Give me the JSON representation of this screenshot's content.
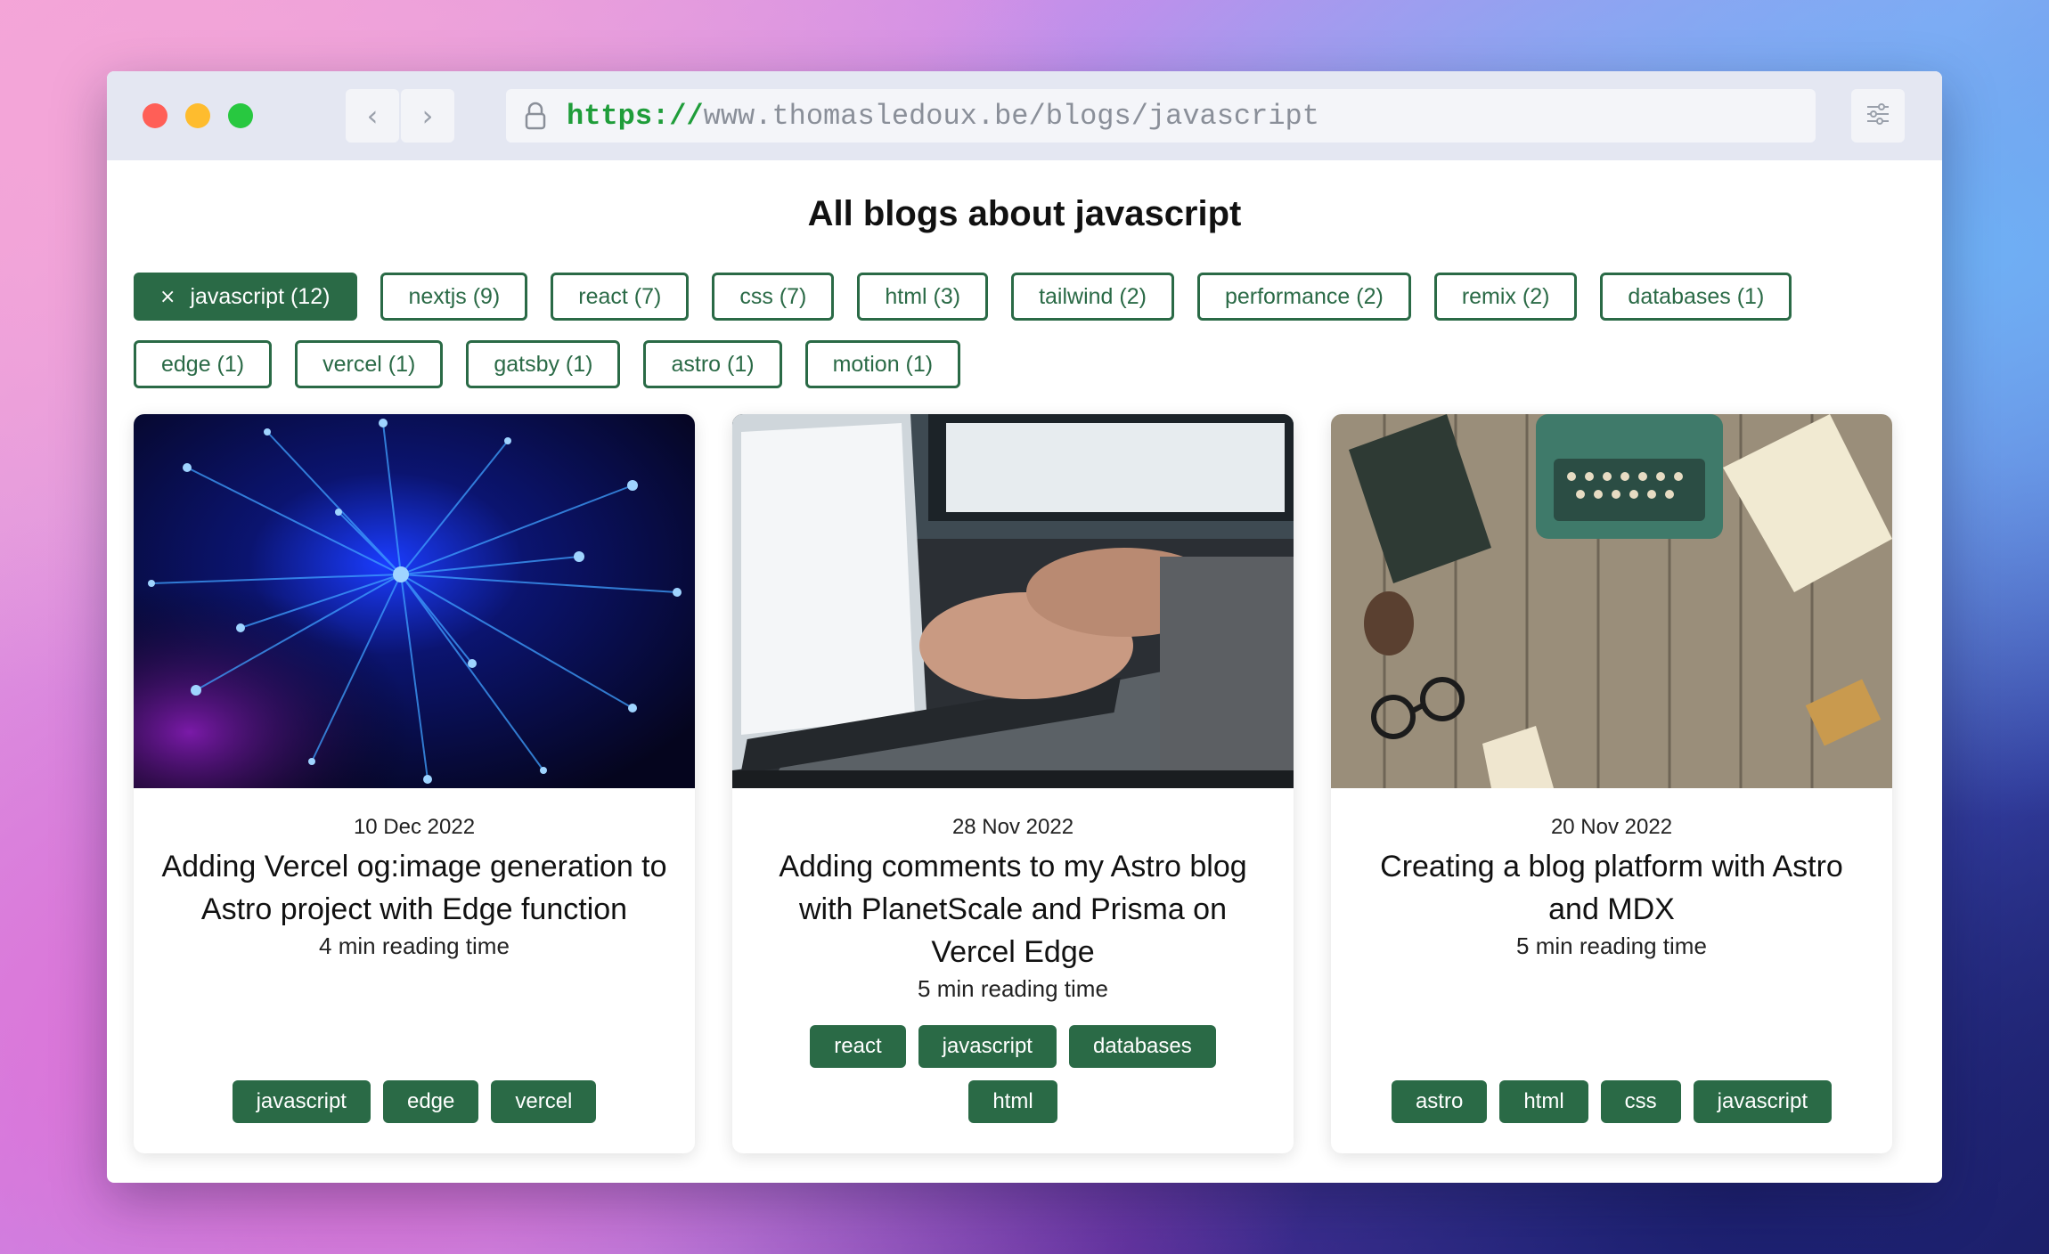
{
  "browser": {
    "url_scheme": "https://",
    "url_rest": "www.thomasledoux.be/blogs/javascript",
    "back_glyph": "‹",
    "forward_glyph": "›"
  },
  "page": {
    "title": "All blogs about javascript"
  },
  "filters": [
    {
      "label": "javascript (12)",
      "active": true,
      "remove_glyph": "×"
    },
    {
      "label": "nextjs (9)",
      "active": false
    },
    {
      "label": "react (7)",
      "active": false
    },
    {
      "label": "css (7)",
      "active": false
    },
    {
      "label": "html (3)",
      "active": false
    },
    {
      "label": "tailwind (2)",
      "active": false
    },
    {
      "label": "performance (2)",
      "active": false
    },
    {
      "label": "remix (2)",
      "active": false
    },
    {
      "label": "databases (1)",
      "active": false
    },
    {
      "label": "edge (1)",
      "active": false
    },
    {
      "label": "vercel (1)",
      "active": false
    },
    {
      "label": "gatsby (1)",
      "active": false
    },
    {
      "label": "astro (1)",
      "active": false
    },
    {
      "label": "motion (1)",
      "active": false
    }
  ],
  "cards": [
    {
      "image_icon": "fiber-optic-image",
      "date": "10 Dec 2022",
      "title": "Adding Vercel og:image generation to Astro project with Edge function",
      "reading_time": "4 min reading time",
      "tags": [
        "javascript",
        "edge",
        "vercel"
      ]
    },
    {
      "image_icon": "laptop-typing-image",
      "date": "28 Nov 2022",
      "title": "Adding comments to my Astro blog with PlanetScale and Prisma on Vercel Edge",
      "reading_time": "5 min reading time",
      "tags": [
        "react",
        "javascript",
        "databases",
        "html"
      ]
    },
    {
      "image_icon": "typewriter-desk-image",
      "date": "20 Nov 2022",
      "title": "Creating a blog platform with Astro and MDX",
      "reading_time": "5 min reading time",
      "tags": [
        "astro",
        "html",
        "css",
        "javascript"
      ]
    }
  ],
  "colors": {
    "brand_green": "#2a6a46",
    "url_green": "#1f9d3a"
  }
}
